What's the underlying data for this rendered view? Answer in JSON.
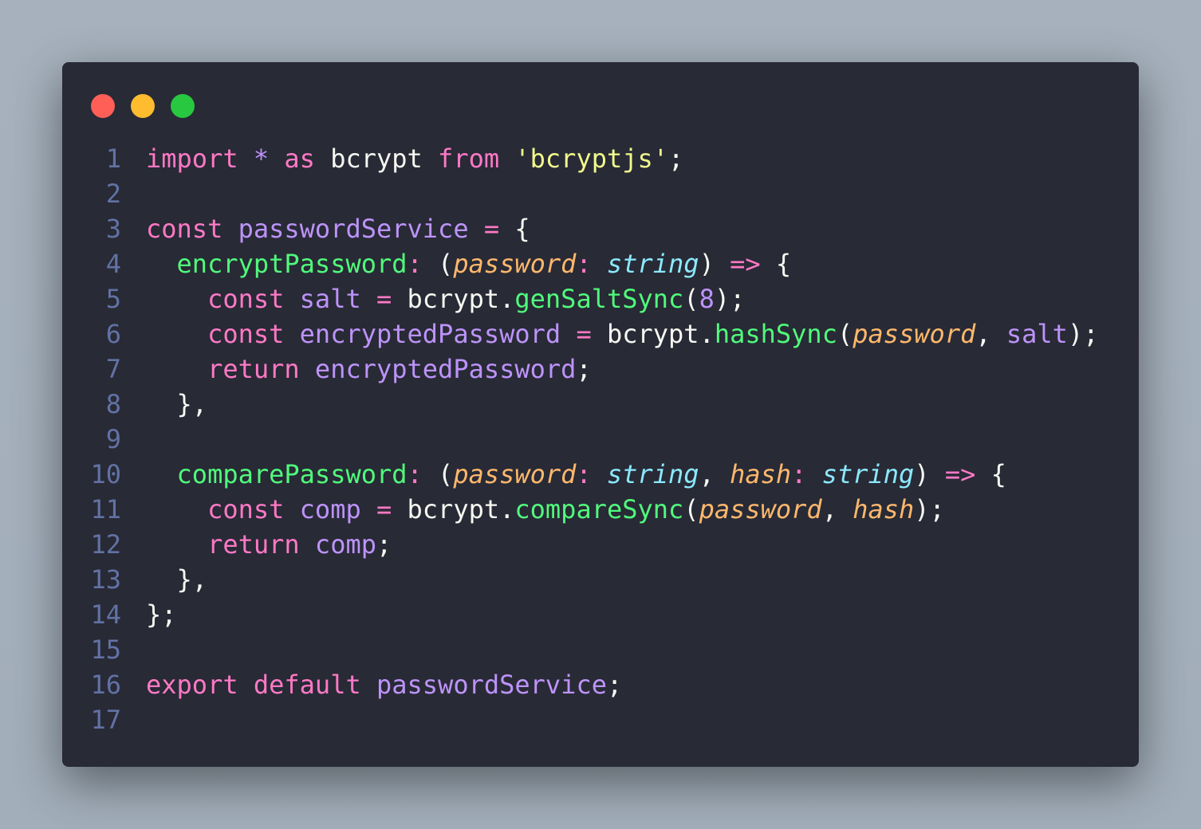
{
  "window_controls": {
    "close_color": "#ff5f57",
    "minimize_color": "#febc2e",
    "maximize_color": "#28c840"
  },
  "code": {
    "language": "typescript",
    "lines": [
      [
        [
          "import",
          "kw"
        ],
        [
          " ",
          "pl"
        ],
        [
          "*",
          "vr"
        ],
        [
          " ",
          "pl"
        ],
        [
          "as",
          "kw"
        ],
        [
          " bcrypt ",
          "pl"
        ],
        [
          "from",
          "kw"
        ],
        [
          " ",
          "pl"
        ],
        [
          "'bcryptjs'",
          "st"
        ],
        [
          ";",
          "pl"
        ]
      ],
      [],
      [
        [
          "const",
          "kw"
        ],
        [
          " ",
          "pl"
        ],
        [
          "passwordService",
          "vr"
        ],
        [
          " ",
          "pl"
        ],
        [
          "=",
          "kw"
        ],
        [
          " {",
          "pl"
        ]
      ],
      [
        [
          "  ",
          "pl"
        ],
        [
          "encryptPassword",
          "fn"
        ],
        [
          ":",
          "kw"
        ],
        [
          " (",
          "pl"
        ],
        [
          "password",
          "pa"
        ],
        [
          ":",
          "kw"
        ],
        [
          " ",
          "pl"
        ],
        [
          "string",
          "ty"
        ],
        [
          ") ",
          "pl"
        ],
        [
          "=>",
          "kw"
        ],
        [
          " {",
          "pl"
        ]
      ],
      [
        [
          "    ",
          "pl"
        ],
        [
          "const",
          "kw"
        ],
        [
          " ",
          "pl"
        ],
        [
          "salt",
          "vr"
        ],
        [
          " ",
          "pl"
        ],
        [
          "=",
          "kw"
        ],
        [
          " bcrypt.",
          "pl"
        ],
        [
          "genSaltSync",
          "fn"
        ],
        [
          "(",
          "pl"
        ],
        [
          "8",
          "vr"
        ],
        [
          ");",
          "pl"
        ]
      ],
      [
        [
          "    ",
          "pl"
        ],
        [
          "const",
          "kw"
        ],
        [
          " ",
          "pl"
        ],
        [
          "encryptedPassword",
          "vr"
        ],
        [
          " ",
          "pl"
        ],
        [
          "=",
          "kw"
        ],
        [
          " bcrypt.",
          "pl"
        ],
        [
          "hashSync",
          "fn"
        ],
        [
          "(",
          "pl"
        ],
        [
          "password",
          "pa"
        ],
        [
          ", ",
          "pl"
        ],
        [
          "salt",
          "vr"
        ],
        [
          ");",
          "pl"
        ]
      ],
      [
        [
          "    ",
          "pl"
        ],
        [
          "return",
          "kw"
        ],
        [
          " ",
          "pl"
        ],
        [
          "encryptedPassword",
          "vr"
        ],
        [
          ";",
          "pl"
        ]
      ],
      [
        [
          "  },",
          "pl"
        ]
      ],
      [],
      [
        [
          "  ",
          "pl"
        ],
        [
          "comparePassword",
          "fn"
        ],
        [
          ":",
          "kw"
        ],
        [
          " (",
          "pl"
        ],
        [
          "password",
          "pa"
        ],
        [
          ":",
          "kw"
        ],
        [
          " ",
          "pl"
        ],
        [
          "string",
          "ty"
        ],
        [
          ", ",
          "pl"
        ],
        [
          "hash",
          "pa"
        ],
        [
          ":",
          "kw"
        ],
        [
          " ",
          "pl"
        ],
        [
          "string",
          "ty"
        ],
        [
          ") ",
          "pl"
        ],
        [
          "=>",
          "kw"
        ],
        [
          " {",
          "pl"
        ]
      ],
      [
        [
          "    ",
          "pl"
        ],
        [
          "const",
          "kw"
        ],
        [
          " ",
          "pl"
        ],
        [
          "comp",
          "vr"
        ],
        [
          " ",
          "pl"
        ],
        [
          "=",
          "kw"
        ],
        [
          " bcrypt.",
          "pl"
        ],
        [
          "compareSync",
          "fn"
        ],
        [
          "(",
          "pl"
        ],
        [
          "password",
          "pa"
        ],
        [
          ", ",
          "pl"
        ],
        [
          "hash",
          "pa"
        ],
        [
          ");",
          "pl"
        ]
      ],
      [
        [
          "    ",
          "pl"
        ],
        [
          "return",
          "kw"
        ],
        [
          " ",
          "pl"
        ],
        [
          "comp",
          "vr"
        ],
        [
          ";",
          "pl"
        ]
      ],
      [
        [
          "  },",
          "pl"
        ]
      ],
      [
        [
          "};",
          "pl"
        ]
      ],
      [],
      [
        [
          "export",
          "kw"
        ],
        [
          " ",
          "pl"
        ],
        [
          "default",
          "kw"
        ],
        [
          " ",
          "pl"
        ],
        [
          "passwordService",
          "vr"
        ],
        [
          ";",
          "pl"
        ]
      ],
      []
    ]
  }
}
